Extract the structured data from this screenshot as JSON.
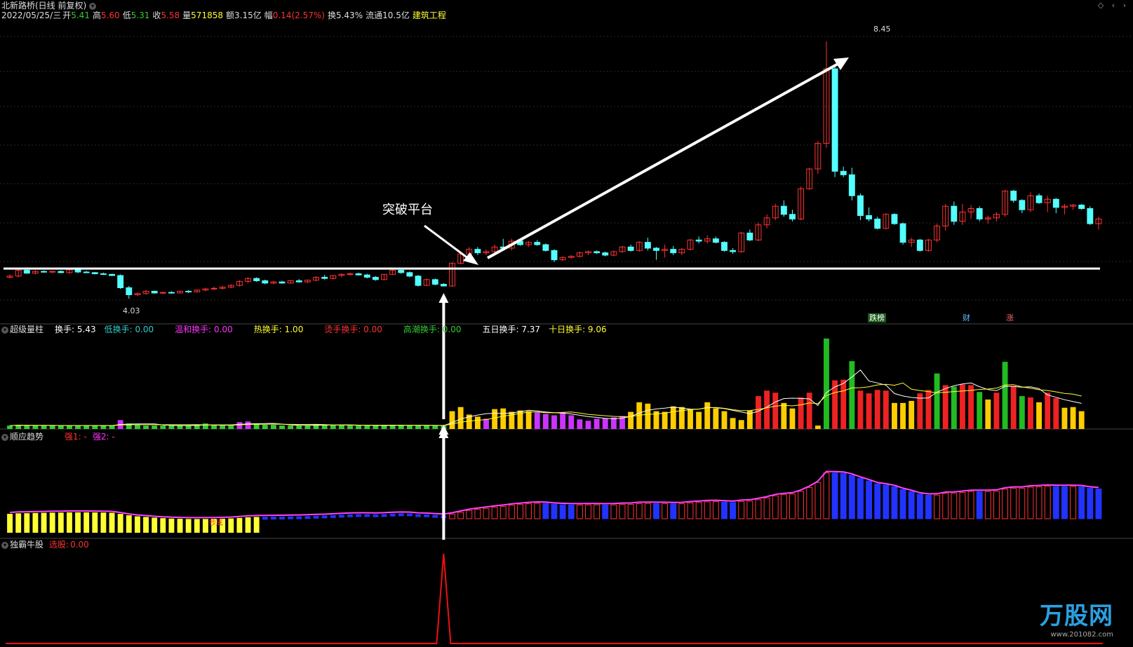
{
  "header": {
    "stock_name": "北新路桥(日线 前复权)",
    "date": "2022/05/25/三",
    "open_label": "开",
    "open": "5.41",
    "high_label": "高",
    "high": "5.60",
    "low_label": "低",
    "low": "5.31",
    "close_label": "收",
    "close": "5.58",
    "vol_label": "量",
    "vol": "571858",
    "amt_label": "额",
    "amt": "3.15亿",
    "chg_label": "幅",
    "chg": "0.14(2.57%)",
    "turn_label": "换",
    "turn": "5.43%",
    "float_label": "流通",
    "float": "10.5亿",
    "sector": "建筑工程"
  },
  "price_pane": {
    "annotation": "突破平台",
    "high_label": "8.45",
    "low_label": "4.03",
    "badges": [
      "跌榜",
      "财",
      "涨"
    ]
  },
  "vol_pane": {
    "title": "超级量柱",
    "items": [
      {
        "label": "换手:",
        "value": "5.43",
        "color": "#ffffff"
      },
      {
        "label": "低换手:",
        "value": "0.00",
        "color": "#33cccc"
      },
      {
        "label": "温和换手:",
        "value": "0.00",
        "color": "#ff33ff"
      },
      {
        "label": "热换手:",
        "value": "1.00",
        "color": "#ffff33"
      },
      {
        "label": "烫手换手:",
        "value": "0.00",
        "color": "#ff3333"
      },
      {
        "label": "高潮换手:",
        "value": "0.00",
        "color": "#33cc33"
      },
      {
        "label": "五日换手:",
        "value": "7.37",
        "color": "#ffffff"
      },
      {
        "label": "十日换手:",
        "value": "9.06",
        "color": "#ffff33"
      }
    ]
  },
  "trend_pane": {
    "title": "顺应趋势",
    "s1": "强1: -",
    "s2": "强2: -",
    "marker": "抄底"
  },
  "bull_pane": {
    "title": "独霸牛股",
    "label": "选股:",
    "value": "0.00"
  },
  "watermark": {
    "brand": "万股网",
    "url": "www.201082.com"
  },
  "colors": {
    "up": "#ff3232",
    "down": "#54ffff",
    "line": "#ffffff",
    "bg": "#000000"
  },
  "chart_data": {
    "type": "candlestick",
    "y_range": [
      3.6,
      8.8
    ],
    "candles": [
      [
        4.4,
        4.45,
        4.38,
        4.42
      ],
      [
        4.42,
        4.55,
        4.4,
        4.52
      ],
      [
        4.52,
        4.54,
        4.46,
        4.47
      ],
      [
        4.47,
        4.52,
        4.45,
        4.5
      ],
      [
        4.5,
        4.52,
        4.48,
        4.49
      ],
      [
        4.49,
        4.51,
        4.47,
        4.5
      ],
      [
        4.5,
        4.52,
        4.47,
        4.48
      ],
      [
        4.48,
        4.55,
        4.46,
        4.53
      ],
      [
        4.53,
        4.54,
        4.47,
        4.49
      ],
      [
        4.49,
        4.51,
        4.47,
        4.48
      ],
      [
        4.48,
        4.49,
        4.45,
        4.46
      ],
      [
        4.46,
        4.48,
        4.44,
        4.45
      ],
      [
        4.45,
        4.46,
        4.42,
        4.43
      ],
      [
        4.43,
        4.45,
        4.2,
        4.22
      ],
      [
        4.22,
        4.25,
        4.03,
        4.1
      ],
      [
        4.1,
        4.14,
        4.08,
        4.12
      ],
      [
        4.12,
        4.18,
        4.1,
        4.16
      ],
      [
        4.16,
        4.17,
        4.12,
        4.13
      ],
      [
        4.13,
        4.15,
        4.11,
        4.14
      ],
      [
        4.14,
        4.16,
        4.12,
        4.13
      ],
      [
        4.13,
        4.17,
        4.12,
        4.16
      ],
      [
        4.16,
        4.18,
        4.13,
        4.15
      ],
      [
        4.15,
        4.19,
        4.14,
        4.18
      ],
      [
        4.18,
        4.22,
        4.16,
        4.2
      ],
      [
        4.2,
        4.24,
        4.18,
        4.21
      ],
      [
        4.21,
        4.25,
        4.19,
        4.23
      ],
      [
        4.23,
        4.28,
        4.21,
        4.26
      ],
      [
        4.26,
        4.35,
        4.24,
        4.33
      ],
      [
        4.33,
        4.4,
        4.3,
        4.38
      ],
      [
        4.38,
        4.4,
        4.32,
        4.34
      ],
      [
        4.34,
        4.36,
        4.28,
        4.3
      ],
      [
        4.3,
        4.34,
        4.28,
        4.32
      ],
      [
        4.32,
        4.34,
        4.29,
        4.3
      ],
      [
        4.3,
        4.35,
        4.29,
        4.34
      ],
      [
        4.34,
        4.37,
        4.31,
        4.32
      ],
      [
        4.32,
        4.36,
        4.3,
        4.35
      ],
      [
        4.35,
        4.42,
        4.33,
        4.4
      ],
      [
        4.4,
        4.44,
        4.36,
        4.38
      ],
      [
        4.38,
        4.44,
        4.36,
        4.43
      ],
      [
        4.43,
        4.47,
        4.4,
        4.45
      ],
      [
        4.45,
        4.48,
        4.43,
        4.46
      ],
      [
        4.46,
        4.48,
        4.43,
        4.44
      ],
      [
        4.44,
        4.46,
        4.38,
        4.4
      ],
      [
        4.4,
        4.42,
        4.34,
        4.36
      ],
      [
        4.36,
        4.46,
        4.35,
        4.45
      ],
      [
        4.45,
        4.54,
        4.44,
        4.52
      ],
      [
        4.52,
        4.56,
        4.46,
        4.48
      ],
      [
        4.48,
        4.5,
        4.4,
        4.42
      ],
      [
        4.42,
        4.44,
        4.24,
        4.26
      ],
      [
        4.26,
        4.38,
        4.25,
        4.36
      ],
      [
        4.36,
        4.38,
        4.26,
        4.28
      ],
      [
        4.28,
        4.3,
        4.24,
        4.25
      ],
      [
        4.25,
        4.66,
        4.24,
        4.64
      ],
      [
        4.64,
        4.82,
        4.62,
        4.8
      ],
      [
        4.8,
        4.92,
        4.76,
        4.88
      ],
      [
        4.88,
        4.92,
        4.78,
        4.82
      ],
      [
        4.82,
        4.88,
        4.78,
        4.84
      ],
      [
        4.84,
        4.96,
        4.8,
        4.92
      ],
      [
        4.92,
        5.06,
        4.86,
        4.9
      ],
      [
        4.9,
        5.06,
        4.86,
        5.02
      ],
      [
        5.02,
        5.06,
        4.94,
        4.96
      ],
      [
        4.96,
        5.02,
        4.92,
        5.0
      ],
      [
        5.0,
        5.04,
        4.94,
        4.96
      ],
      [
        4.96,
        4.98,
        4.84,
        4.86
      ],
      [
        4.86,
        4.88,
        4.66,
        4.7
      ],
      [
        4.7,
        4.76,
        4.68,
        4.74
      ],
      [
        4.74,
        4.78,
        4.72,
        4.76
      ],
      [
        4.76,
        4.84,
        4.74,
        4.82
      ],
      [
        4.82,
        4.86,
        4.78,
        4.84
      ],
      [
        4.84,
        4.86,
        4.8,
        4.82
      ],
      [
        4.82,
        4.84,
        4.76,
        4.78
      ],
      [
        4.78,
        4.86,
        4.76,
        4.84
      ],
      [
        4.84,
        4.94,
        4.82,
        4.92
      ],
      [
        4.92,
        4.96,
        4.84,
        4.86
      ],
      [
        4.86,
        5.02,
        4.84,
        5.0
      ],
      [
        5.0,
        5.08,
        4.86,
        4.9
      ],
      [
        4.9,
        4.92,
        4.7,
        4.86
      ],
      [
        4.86,
        4.96,
        4.74,
        4.88
      ],
      [
        4.88,
        4.94,
        4.78,
        4.82
      ],
      [
        4.82,
        4.9,
        4.78,
        4.88
      ],
      [
        4.88,
        5.06,
        4.86,
        5.04
      ],
      [
        5.04,
        5.1,
        4.98,
        5.02
      ],
      [
        5.02,
        5.12,
        4.98,
        5.06
      ],
      [
        5.06,
        5.1,
        4.98,
        5.0
      ],
      [
        5.0,
        5.02,
        4.84,
        4.86
      ],
      [
        4.86,
        4.9,
        4.8,
        4.84
      ],
      [
        4.84,
        5.18,
        4.82,
        5.16
      ],
      [
        5.16,
        5.22,
        5.02,
        5.04
      ],
      [
        5.04,
        5.34,
        5.02,
        5.3
      ],
      [
        5.3,
        5.48,
        5.24,
        5.42
      ],
      [
        5.42,
        5.66,
        5.38,
        5.62
      ],
      [
        5.62,
        5.72,
        5.44,
        5.48
      ],
      [
        5.48,
        5.56,
        5.36,
        5.4
      ],
      [
        5.4,
        5.96,
        5.38,
        5.92
      ],
      [
        5.92,
        6.28,
        5.9,
        6.26
      ],
      [
        6.26,
        6.74,
        6.18,
        6.7
      ],
      [
        6.7,
        8.45,
        6.62,
        7.98
      ],
      [
        7.98,
        8.02,
        6.12,
        6.22
      ],
      [
        6.22,
        6.3,
        6.12,
        6.16
      ],
      [
        6.16,
        6.28,
        5.72,
        5.8
      ],
      [
        5.8,
        5.84,
        5.38,
        5.46
      ],
      [
        5.46,
        5.6,
        5.36,
        5.4
      ],
      [
        5.4,
        5.44,
        5.22,
        5.24
      ],
      [
        5.24,
        5.5,
        5.22,
        5.48
      ],
      [
        5.48,
        5.5,
        5.3,
        5.32
      ],
      [
        5.32,
        5.34,
        4.96,
        5.0
      ],
      [
        5.0,
        5.08,
        4.92,
        5.04
      ],
      [
        5.04,
        5.06,
        4.84,
        4.86
      ],
      [
        4.86,
        5.06,
        4.84,
        5.04
      ],
      [
        5.04,
        5.32,
        5.0,
        5.28
      ],
      [
        5.28,
        5.66,
        5.2,
        5.62
      ],
      [
        5.62,
        5.7,
        5.3,
        5.36
      ],
      [
        5.36,
        5.66,
        5.3,
        5.52
      ],
      [
        5.52,
        5.64,
        5.4,
        5.58
      ],
      [
        5.58,
        5.62,
        5.36,
        5.4
      ],
      [
        5.4,
        5.46,
        5.32,
        5.42
      ],
      [
        5.42,
        5.52,
        5.36,
        5.48
      ],
      [
        5.48,
        5.9,
        5.44,
        5.88
      ],
      [
        5.88,
        5.9,
        5.68,
        5.72
      ],
      [
        5.72,
        5.74,
        5.5,
        5.56
      ],
      [
        5.56,
        5.86,
        5.52,
        5.8
      ],
      [
        5.8,
        5.84,
        5.66,
        5.68
      ],
      [
        5.68,
        5.8,
        5.52,
        5.74
      ],
      [
        5.74,
        5.76,
        5.5,
        5.6
      ],
      [
        5.6,
        5.66,
        5.48,
        5.62
      ],
      [
        5.62,
        5.66,
        5.56,
        5.64
      ],
      [
        5.64,
        5.66,
        5.56,
        5.58
      ],
      [
        5.58,
        5.62,
        5.3,
        5.32
      ],
      [
        5.32,
        5.44,
        5.22,
        5.4
      ]
    ],
    "volume": [
      0.5,
      0.6,
      0.5,
      0.5,
      0.5,
      0.5,
      0.5,
      0.5,
      0.5,
      0.5,
      0.5,
      0.5,
      0.5,
      1.3,
      0.8,
      0.6,
      0.5,
      0.5,
      0.5,
      0.5,
      0.5,
      0.5,
      0.6,
      0.8,
      0.6,
      0.5,
      0.5,
      1.0,
      1.1,
      0.8,
      0.6,
      0.6,
      0.5,
      0.5,
      0.5,
      0.5,
      0.7,
      0.6,
      0.6,
      0.6,
      0.5,
      0.5,
      0.5,
      0.5,
      0.5,
      0.6,
      0.6,
      0.5,
      0.5,
      0.5,
      0.5,
      0.5,
      2.6,
      3.2,
      2.1,
      1.8,
      1.5,
      2.9,
      3.0,
      2.5,
      2.7,
      2.6,
      2.4,
      2.2,
      2.0,
      2.4,
      2.0,
      1.4,
      1.2,
      1.5,
      1.6,
      1.7,
      1.9,
      2.5,
      3.9,
      3.7,
      2.6,
      2.5,
      3.3,
      3.2,
      2.9,
      2.5,
      3.9,
      3.0,
      2.6,
      1.6,
      1.3,
      2.7,
      4.8,
      5.6,
      5.3,
      3.8,
      3.0,
      4.6,
      5.3,
      0.5,
      13.2,
      7.1,
      7.2,
      9.9,
      5.6,
      5.2,
      5.7,
      5.6,
      3.8,
      3.8,
      4.1,
      5.2,
      5.7,
      8.1,
      6.4,
      6.2,
      6.5,
      6.4,
      5.4,
      4.3,
      5.3,
      9.8,
      6.3,
      4.8,
      4.6,
      3.9,
      5.3,
      4.5,
      3.1,
      3.2,
      2.6
    ],
    "turnover_ma5": "7.37",
    "turnover_ma10": "9.06",
    "bull_signal_index": 51
  }
}
